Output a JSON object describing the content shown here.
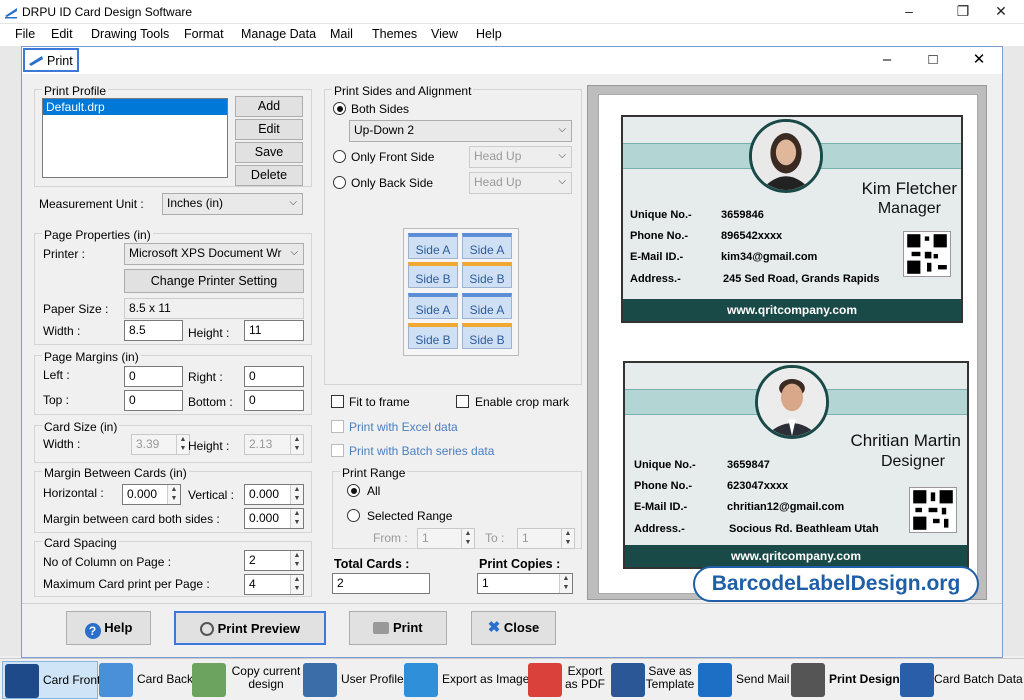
{
  "app": {
    "title": "DRPU ID Card Design Software",
    "menu": [
      "File",
      "Edit",
      "Drawing Tools",
      "Format",
      "Manage Data",
      "Mail",
      "Themes",
      "View",
      "Help"
    ]
  },
  "dialog": {
    "title": "Print",
    "print_profile": {
      "label": "Print Profile",
      "items": [
        "Default.drp"
      ],
      "add": "Add",
      "edit": "Edit",
      "save": "Save",
      "delete": "Delete"
    },
    "measurement": {
      "label": "Measurement Unit :",
      "value": "Inches (in)"
    },
    "page_properties": {
      "label": "Page Properties (in)",
      "printer_label": "Printer :",
      "printer_value": "Microsoft XPS Document Wr",
      "change_printer": "Change Printer Setting",
      "paper_size_label": "Paper Size :",
      "paper_size_value": "8.5 x 11",
      "width_label": "Width :",
      "width_value": "8.5",
      "height_label": "Height :",
      "height_value": "11"
    },
    "page_margins": {
      "label": "Page Margins (in)",
      "left_label": "Left :",
      "left_value": "0",
      "right_label": "Right :",
      "right_value": "0",
      "top_label": "Top :",
      "top_value": "0",
      "bottom_label": "Bottom :",
      "bottom_value": "0"
    },
    "card_size": {
      "label": "Card Size (in)",
      "width_label": "Width :",
      "width_value": "3.39",
      "height_label": "Height :",
      "height_value": "2.13"
    },
    "margin_cards": {
      "label": "Margin Between Cards (in)",
      "horizontal_label": "Horizontal :",
      "horizontal_value": "0.000",
      "vertical_label": "Vertical :",
      "vertical_value": "0.000",
      "both_label": "Margin between card both sides :",
      "both_value": "0.000"
    },
    "card_spacing": {
      "label": "Card Spacing",
      "columns_label": "No of Column on Page :",
      "columns_value": "2",
      "max_label": "Maximum Card print per Page :",
      "max_value": "4"
    },
    "sides": {
      "label": "Print Sides and Alignment",
      "both": "Both Sides",
      "both_select": "Up-Down 2",
      "front": "Only Front Side",
      "front_select": "Head Up",
      "back": "Only Back Side",
      "back_select": "Head Up",
      "tiles": [
        "Side A",
        "Side A",
        "Side B",
        "Side B",
        "Side A",
        "Side A",
        "Side B",
        "Side B"
      ]
    },
    "options": {
      "fit": "Fit to frame",
      "crop": "Enable crop mark",
      "excel": "Print with Excel data",
      "batch": "Print with Batch series data"
    },
    "range": {
      "label": "Print Range",
      "all": "All",
      "selected": "Selected Range",
      "from_label": "From :",
      "from_value": "1",
      "to_label": "To :",
      "to_value": "1"
    },
    "totals": {
      "total_label": "Total Cards :",
      "total_value": "2",
      "copies_label": "Print Copies :",
      "copies_value": "1"
    },
    "buttons": {
      "help": "Help",
      "preview": "Print Preview",
      "print": "Print",
      "close": "Close"
    }
  },
  "cards": [
    {
      "name": "Kim Fletcher",
      "title": "Manager",
      "unique_label": "Unique No.-",
      "unique": "3659846",
      "phone_label": "Phone No.-",
      "phone": "896542xxxx",
      "email_label": "E-Mail ID.-",
      "email": "kim34@gmail.com",
      "address_label": "Address.-",
      "address": "245 Sed Road, Grands Rapids",
      "website": "www.qritcompany.com"
    },
    {
      "name": "Chritian Martin",
      "title": "Designer",
      "unique_label": "Unique No.-",
      "unique": "3659847",
      "phone_label": "Phone No.-",
      "phone": "623047xxxx",
      "email_label": "E-Mail ID.-",
      "email": "chritian12@gmail.com",
      "address_label": "Address.-",
      "address": "Socious Rd. Beathleam Utah",
      "website": "www.qritcompany.com"
    }
  ],
  "brand": "BarcodeLabelDesign.org",
  "toolbar": [
    {
      "label": "Card Front",
      "icon": "card-front-icon"
    },
    {
      "label": "Card Back",
      "icon": "card-back-icon"
    },
    {
      "label": "Copy current design",
      "icon": "copy-design-icon"
    },
    {
      "label": "User Profile",
      "icon": "user-profile-icon"
    },
    {
      "label": "Export as Image",
      "icon": "export-image-icon"
    },
    {
      "label": "Export as PDF",
      "icon": "pdf-icon"
    },
    {
      "label": "Save as Template",
      "icon": "template-icon"
    },
    {
      "label": "Send Mail",
      "icon": "mail-icon"
    },
    {
      "label": "Print Design",
      "icon": "printer-icon"
    },
    {
      "label": "Card Batch Data",
      "icon": "batch-data-icon"
    }
  ],
  "colors": {
    "accent": "#3b78d8",
    "card_dark": "#1a4a48",
    "card_band": "#b3d6d5",
    "brand": "#1e5fa8"
  }
}
